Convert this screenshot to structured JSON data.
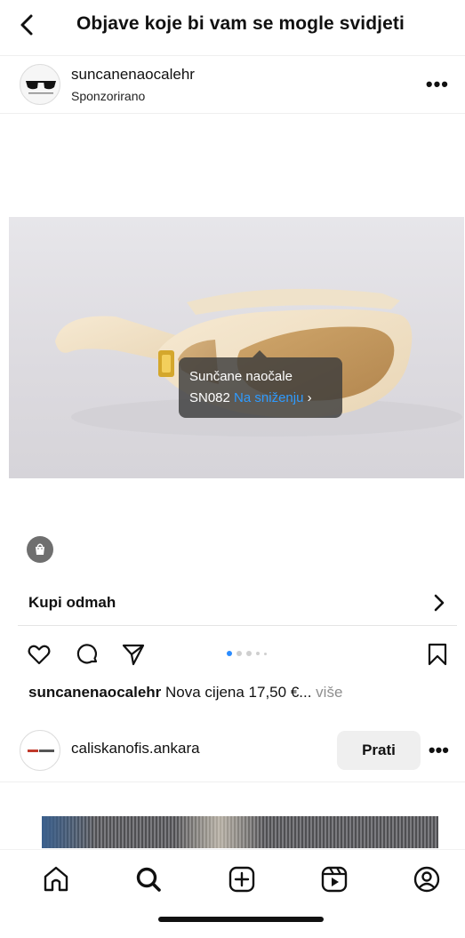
{
  "header": {
    "title": "Objave koje bi vam se mogle svidjeti"
  },
  "post": {
    "username": "suncanenaocalehr",
    "sponsored_label": "Sponzorirano",
    "product_tag": {
      "name": "Sunčane naočale",
      "code": "SN082",
      "sale_label": "Na sniženju",
      "chevron": "›"
    },
    "cta_label": "Kupi odmah",
    "carousel": {
      "total": 5,
      "active": 1
    },
    "caption": {
      "username": "suncanenaocalehr",
      "text": " Nova cijena 17,50 €...",
      "more": " više"
    }
  },
  "next_post": {
    "username": "caliskanofis.ankara",
    "follow_label": "Prati"
  },
  "icons": [
    "back-icon",
    "more-icon",
    "shopping-bag-icon",
    "chevron-right-icon",
    "heart-icon",
    "comment-icon",
    "share-icon",
    "bookmark-icon",
    "home-icon",
    "search-icon",
    "create-icon",
    "reels-icon",
    "profile-icon"
  ],
  "colors": {
    "link": "#2f9bff",
    "carousel_active": "#2a8cff"
  }
}
